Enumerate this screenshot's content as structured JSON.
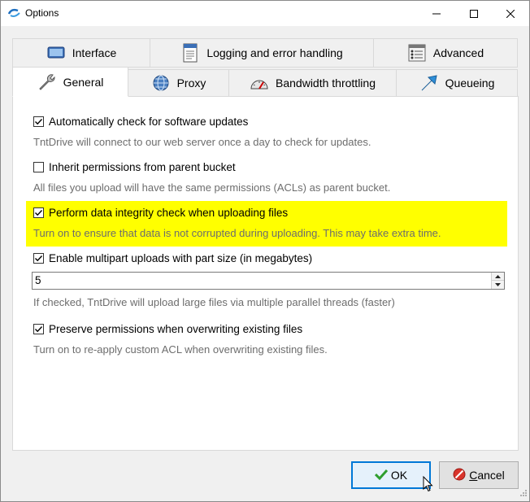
{
  "window": {
    "title": "Options",
    "controls": [
      "minimize",
      "maximize",
      "close"
    ]
  },
  "tabs": {
    "row_back": [
      {
        "label": "Interface",
        "icon": "monitor-icon"
      },
      {
        "label": "Logging and error handling",
        "icon": "document-icon"
      },
      {
        "label": "Advanced",
        "icon": "settings-list-icon"
      }
    ],
    "row_front": [
      {
        "label": "General",
        "icon": "wrench-icon",
        "active": true
      },
      {
        "label": "Proxy",
        "icon": "globe-icon"
      },
      {
        "label": "Bandwidth throttling",
        "icon": "speedometer-icon"
      },
      {
        "label": "Queueing",
        "icon": "arrow-icon"
      }
    ]
  },
  "general": {
    "options": [
      {
        "label": "Automatically check for software updates",
        "checked": true,
        "description": "TntDrive will connect to our web server once a day to check for updates."
      },
      {
        "label": "Inherit permissions from parent bucket",
        "checked": false,
        "description": "All files you upload will have the same permissions (ACLs) as parent bucket."
      },
      {
        "label": "Perform data integrity check when uploading files",
        "checked": true,
        "description": "Turn on to ensure that data is not corrupted during uploading. This may take extra time.",
        "highlighted": true
      },
      {
        "label": "Enable multipart uploads with part size (in megabytes)",
        "checked": true,
        "description": "If checked, TntDrive will upload large files via multiple parallel threads (faster)"
      },
      {
        "label": "Preserve permissions when overwriting existing files",
        "checked": true,
        "description": "Turn on to re-apply custom ACL when overwriting existing files."
      }
    ],
    "part_size_value": "5"
  },
  "buttons": {
    "ok": {
      "label_first": "",
      "label_rest": "OK",
      "icon": "checkmark-icon"
    },
    "cancel": {
      "label_first": "C",
      "label_rest": "ancel",
      "icon": "cancel-icon"
    }
  },
  "colors": {
    "highlight": "#ffff00",
    "accent": "#0078d7",
    "description_text": "#6d6d6d"
  }
}
